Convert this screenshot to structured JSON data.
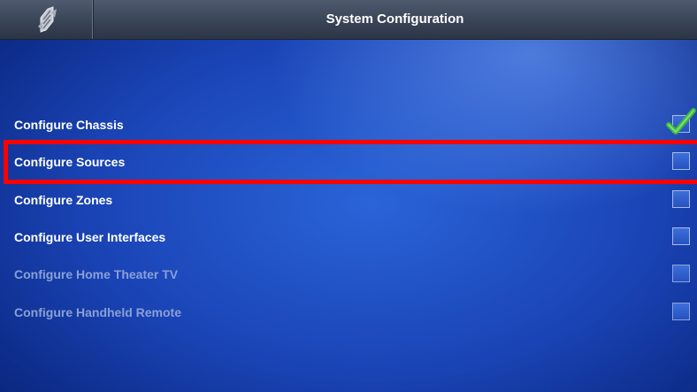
{
  "header": {
    "title": "System Configuration",
    "logo_icon": "crestron-logo-icon"
  },
  "items": [
    {
      "label": "Configure Chassis",
      "checked": true,
      "enabled": true
    },
    {
      "label": "Configure Sources",
      "checked": false,
      "enabled": true,
      "highlighted": true
    },
    {
      "label": "Configure Zones",
      "checked": false,
      "enabled": true
    },
    {
      "label": "Configure User Interfaces",
      "checked": false,
      "enabled": true
    },
    {
      "label": "Configure Home Theater TV",
      "checked": false,
      "enabled": false
    },
    {
      "label": "Configure Handheld Remote",
      "checked": false,
      "enabled": false
    }
  ],
  "colors": {
    "highlight": "#ff0000",
    "checkmark": "#3fb83a",
    "disabled_text": "#8aa0d6"
  }
}
